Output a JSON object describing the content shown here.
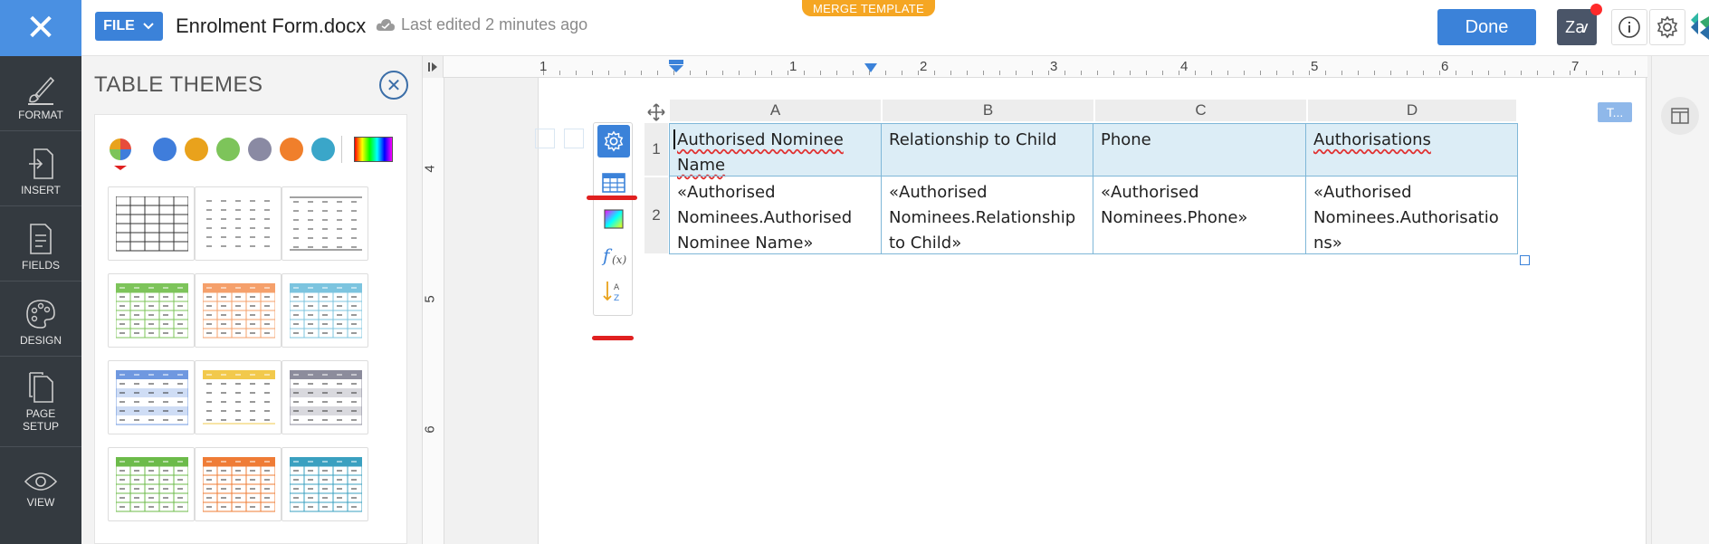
{
  "topbar": {
    "close_glyph": "✕",
    "file_label": "FILE",
    "doc_title": "Enrolment Form.docx",
    "last_edited": "Last edited 2 minutes ago",
    "merge_template": "MERGE TEMPLATE",
    "done_label": "Done",
    "za_label": "Zꜹ",
    "info_glyph": "i"
  },
  "sidebar": {
    "items": [
      {
        "label": "FORMAT",
        "icon": "brush-icon"
      },
      {
        "label": "INSERT",
        "icon": "insert-icon"
      },
      {
        "label": "FIELDS",
        "icon": "fields-icon"
      },
      {
        "label": "DESIGN",
        "icon": "palette-icon"
      },
      {
        "label_line1": "PAGE",
        "label_line2": "SETUP",
        "icon": "page-icon"
      },
      {
        "label": "VIEW",
        "icon": "eye-icon"
      }
    ]
  },
  "themes_panel": {
    "title": "TABLE THEMES",
    "swatch_colors": [
      "#3f7ddb",
      "#e9a21c",
      "#7dc45a",
      "#8a8aa3",
      "#f07f2b",
      "#3aa6c9"
    ],
    "themes": [
      {
        "style": "grid",
        "color": "#333"
      },
      {
        "style": "dashed",
        "color": "#555"
      },
      {
        "style": "lined",
        "color": "#555"
      },
      {
        "style": "header",
        "color": "#7dc45a"
      },
      {
        "style": "header",
        "color": "#f5a06b"
      },
      {
        "style": "header",
        "color": "#7cc4df"
      },
      {
        "style": "banded",
        "color": "#6f98e0"
      },
      {
        "style": "header-light",
        "color": "#f2c94c"
      },
      {
        "style": "banded",
        "color": "#8c8c9c"
      },
      {
        "style": "header",
        "color": "#6cbb4a"
      },
      {
        "style": "header",
        "color": "#ef7c36"
      },
      {
        "style": "header",
        "color": "#3aa0c0"
      }
    ]
  },
  "ruler": {
    "h_labels": [
      "1",
      "1",
      "2",
      "3",
      "4",
      "5",
      "6",
      "7"
    ],
    "v_labels": [
      "4",
      "5",
      "6"
    ]
  },
  "table": {
    "columns": [
      "A",
      "B",
      "C",
      "D"
    ],
    "rows": [
      "1",
      "2"
    ],
    "header_row": [
      "Authorised Nominee Name",
      "Relationship to Child",
      "Phone",
      "Authorisations"
    ],
    "data_row": [
      [
        "«Authorised",
        "Nominees.Authorised",
        "Nominee Name»"
      ],
      [
        "«Authorised",
        "Nominees.Relationship",
        "to Child»"
      ],
      [
        "«Authorised",
        "Nominees.Phone»",
        ""
      ],
      [
        "«Authorised",
        "Nominees.Authorisatio",
        "ns»"
      ]
    ]
  },
  "badge": "T..."
}
